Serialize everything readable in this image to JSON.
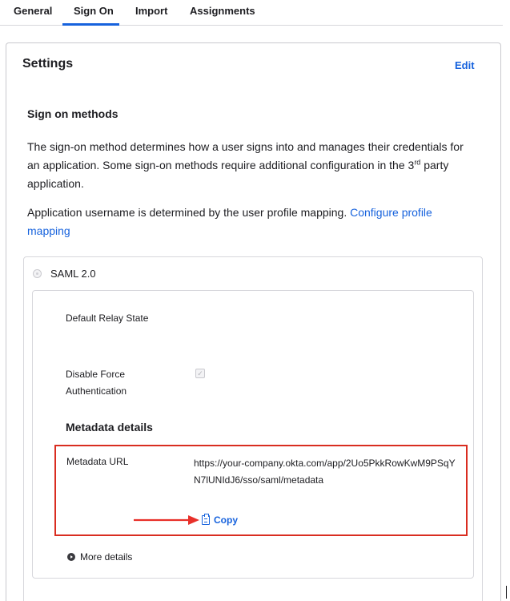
{
  "tabs": [
    {
      "label": "General"
    },
    {
      "label": "Sign On"
    },
    {
      "label": "Import"
    },
    {
      "label": "Assignments"
    }
  ],
  "active_tab": "Sign On",
  "settings": {
    "title": "Settings",
    "edit_label": "Edit"
  },
  "sign_on_methods": {
    "heading": "Sign on methods",
    "description_part1": "The sign-on method determines how a user signs into and manages their credentials for an application. Some sign-on methods require additional configuration in the 3",
    "description_sup": "rd",
    "description_part2": " party application.",
    "username_text": "Application username is determined by the user profile mapping. ",
    "configure_link": "Configure profile mapping"
  },
  "saml": {
    "option_label": "SAML 2.0",
    "relay_state_label": "Default Relay State",
    "force_auth_label": "Disable Force Authentication",
    "force_auth_checked": true,
    "metadata_heading": "Metadata details",
    "metadata_url_label": "Metadata URL",
    "metadata_url": "https://your-company.okta.com/app/2Uo5PkkRowKwM9PSqYN7lUNIdJ6/sso/saml/metadata",
    "copy_label": "Copy",
    "more_details_label": "More details"
  },
  "colors": {
    "accent": "#1662dd",
    "highlight_border": "#d92d20",
    "arrow": "#e8302a"
  }
}
